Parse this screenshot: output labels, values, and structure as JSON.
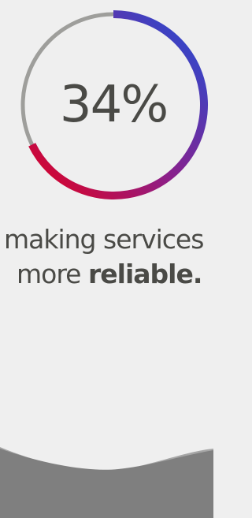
{
  "stat": {
    "percent_label": "34%",
    "value_fraction": 0.34
  },
  "caption": {
    "line1": "making services",
    "line2_prefix": "more ",
    "line2_bold": "reliable."
  },
  "colors": {
    "background": "#efefef",
    "track": "#9e9e9b",
    "gradient_start": "#e1001f",
    "gradient_mid": "#8b1f8a",
    "gradient_end": "#1f4fd8",
    "text": "#4a4a46",
    "wave_dark": "#7f7f7f",
    "wave_light": "#a6a6a6"
  }
}
